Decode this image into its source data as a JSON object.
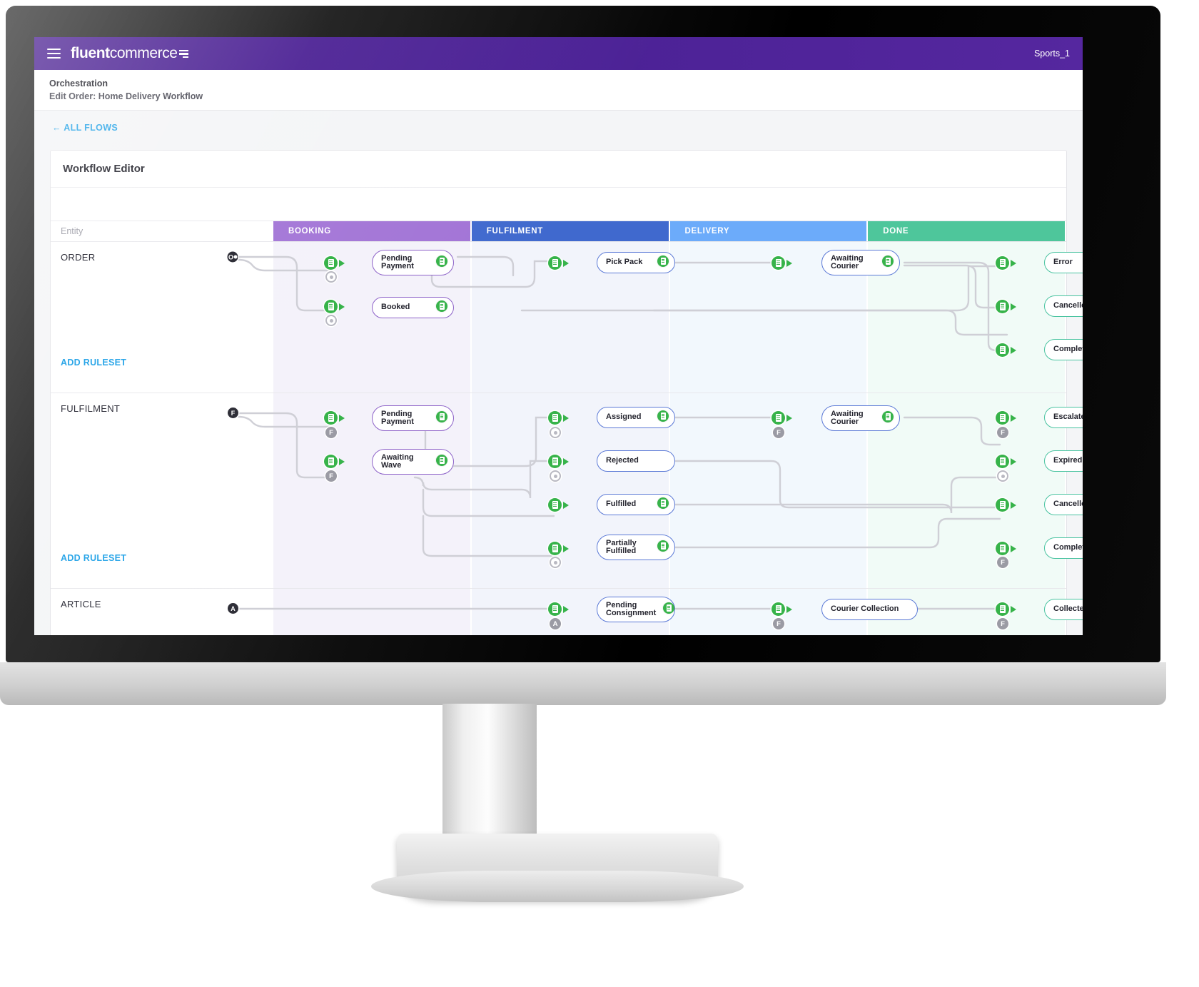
{
  "topbar": {
    "logo_bold": "fluent",
    "logo_normal": "commerce",
    "menu_icon": "hamburger-icon",
    "account": "Sports_1"
  },
  "breadcrumb": {
    "line1": "Orchestration",
    "line2": "Edit Order: Home Delivery Workflow"
  },
  "back_link": "← ALL FLOWS",
  "card": {
    "title": "Workflow Editor"
  },
  "grid": {
    "entity_header": "Entity",
    "stages": [
      {
        "label": "BOOKING",
        "color": "#a274d6"
      },
      {
        "label": "FULFILMENT",
        "color": "#4069ce"
      },
      {
        "label": "DELIVERY",
        "color": "#6cabfa"
      },
      {
        "label": "DONE",
        "color": "#4ec69b"
      }
    ]
  },
  "add_ruleset_label": "ADD RULESET",
  "lanes": [
    {
      "name": "ORDER",
      "start_marker": "O",
      "nodes": [
        {
          "label": "Pending\nPayment",
          "stage": "BOOKING",
          "accent": "purple",
          "has_rule_badge": true
        },
        {
          "label": "Booked",
          "stage": "BOOKING",
          "accent": "purple",
          "has_rule_badge": true
        },
        {
          "label": "Pick Pack",
          "stage": "FULFILMENT",
          "accent": "blue",
          "has_rule_badge": true
        },
        {
          "label": "Awaiting\nCourier",
          "stage": "DELIVERY",
          "accent": "blue",
          "has_rule_badge": true
        },
        {
          "label": "Error",
          "stage": "DONE",
          "accent": "green",
          "has_rule_badge": false
        },
        {
          "label": "Cancelled",
          "stage": "DONE",
          "accent": "green",
          "has_rule_badge": false
        },
        {
          "label": "Complete",
          "stage": "DONE",
          "accent": "green",
          "has_rule_badge": false
        }
      ]
    },
    {
      "name": "FULFILMENT",
      "start_marker": "F",
      "nodes": [
        {
          "label": "Pending\nPayment",
          "stage": "BOOKING",
          "accent": "purple",
          "has_rule_badge": true
        },
        {
          "label": "Awaiting\nWave",
          "stage": "BOOKING",
          "accent": "purple",
          "has_rule_badge": true
        },
        {
          "label": "Assigned",
          "stage": "FULFILMENT",
          "accent": "blue",
          "has_rule_badge": true
        },
        {
          "label": "Rejected",
          "stage": "FULFILMENT",
          "accent": "blue",
          "has_rule_badge": false
        },
        {
          "label": "Fulfilled",
          "stage": "FULFILMENT",
          "accent": "blue",
          "has_rule_badge": true
        },
        {
          "label": "Partially\nFulfilled",
          "stage": "FULFILMENT",
          "accent": "blue",
          "has_rule_badge": true
        },
        {
          "label": "Awaiting\nCourier",
          "stage": "DELIVERY",
          "accent": "blue",
          "has_rule_badge": true
        },
        {
          "label": "Escalated",
          "stage": "DONE",
          "accent": "green",
          "has_rule_badge": false
        },
        {
          "label": "Expired",
          "stage": "DONE",
          "accent": "green",
          "has_rule_badge": false
        },
        {
          "label": "Cancelled",
          "stage": "DONE",
          "accent": "green",
          "has_rule_badge": false
        },
        {
          "label": "Complete",
          "stage": "DONE",
          "accent": "green",
          "has_rule_badge": false
        }
      ]
    },
    {
      "name": "ARTICLE",
      "start_marker": "A",
      "nodes": [
        {
          "label": "Pending\nConsignment",
          "stage": "FULFILMENT",
          "accent": "blue",
          "has_rule_badge": true
        },
        {
          "label": "Courier Collection",
          "stage": "DELIVERY",
          "accent": "blue",
          "has_rule_badge": false
        },
        {
          "label": "Collected",
          "stage": "DONE",
          "accent": "green",
          "has_rule_badge": false
        }
      ]
    }
  ],
  "markers": {
    "order": "O",
    "fulfilment": "F",
    "article": "A"
  }
}
